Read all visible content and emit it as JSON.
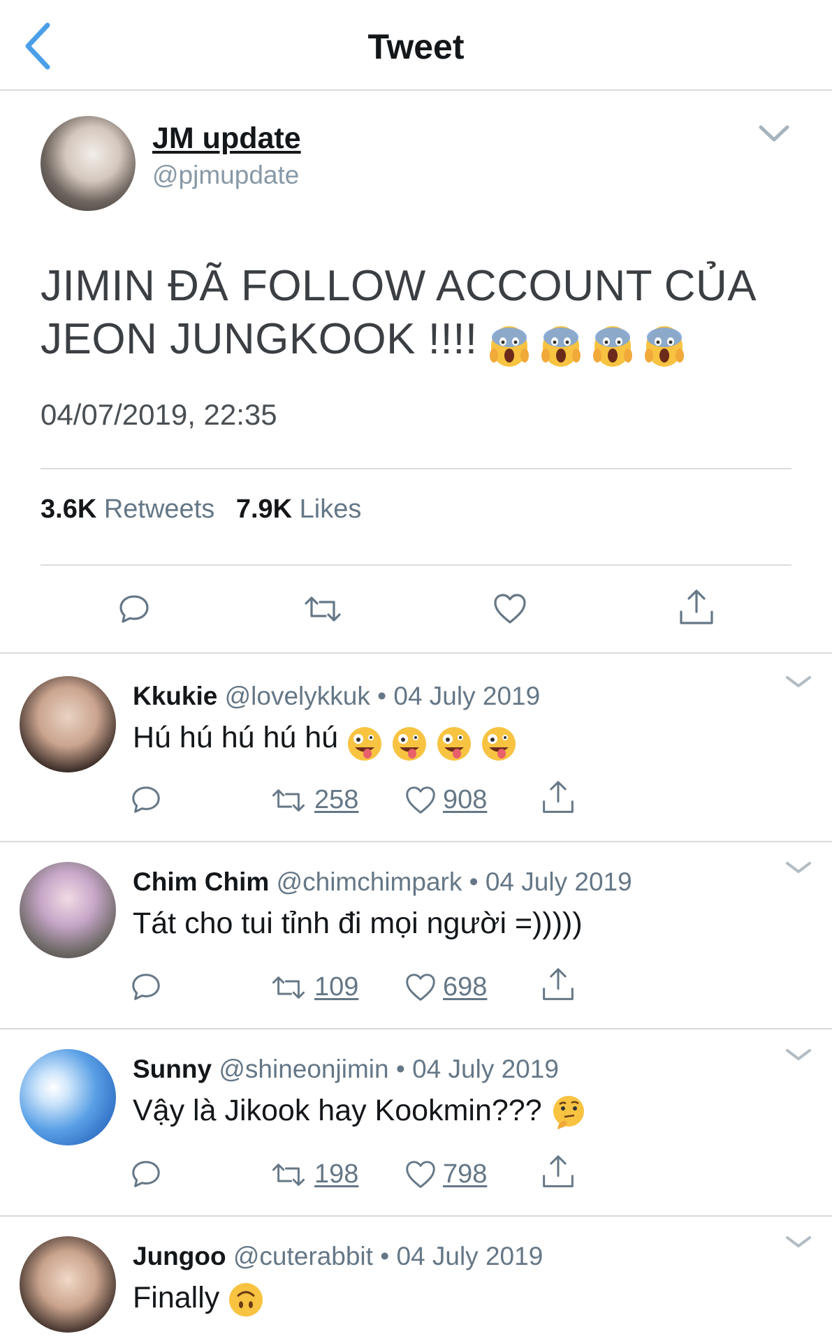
{
  "header": {
    "title": "Tweet",
    "back_icon": "chevron-left-icon",
    "accent": "#4a9fe8"
  },
  "main_tweet": {
    "display_name": "JM update",
    "handle": "@pjmupdate",
    "text_line1": "JIMIN ĐÃ FOLLOW ACCOUNT CỦA",
    "text_line2": "JEON JUNGKOOK !!!!",
    "text_emojis": [
      "screaming-face",
      "screaming-face",
      "screaming-face",
      "screaming-face"
    ],
    "timestamp": "04/07/2019, 22:35",
    "retweets_count": "3.6K",
    "retweets_label": "Retweets",
    "likes_count": "7.9K",
    "likes_label": "Likes",
    "actions": [
      "reply-icon",
      "retweet-icon",
      "like-icon",
      "share-icon"
    ]
  },
  "replies": [
    {
      "name": "Kkukie",
      "handle": "@lovelykkuk",
      "date": "• 04 July 2019",
      "text": "Hú hú hú hú hú",
      "emojis": [
        "zany-face",
        "zany-face",
        "zany-face",
        "zany-face"
      ],
      "retweets": "258",
      "likes": "908"
    },
    {
      "name": "Chim Chim",
      "handle": "@chimchimpark",
      "date": "• 04 July 2019",
      "text": "Tát cho tui tỉnh đi mọi người =)))))",
      "emojis": [],
      "retweets": "109",
      "likes": "698"
    },
    {
      "name": "Sunny",
      "handle": "@shineonjimin",
      "date": "• 04 July 2019",
      "text": "Vậy là Jikook hay Kookmin???",
      "emojis": [
        "thinking-face"
      ],
      "retweets": "198",
      "likes": "798"
    },
    {
      "name": "Jungoo",
      "handle": "@cuterabbit",
      "date": "• 04 July 2019",
      "text": "Finally",
      "emojis": [
        "upside-down-face"
      ]
    }
  ]
}
